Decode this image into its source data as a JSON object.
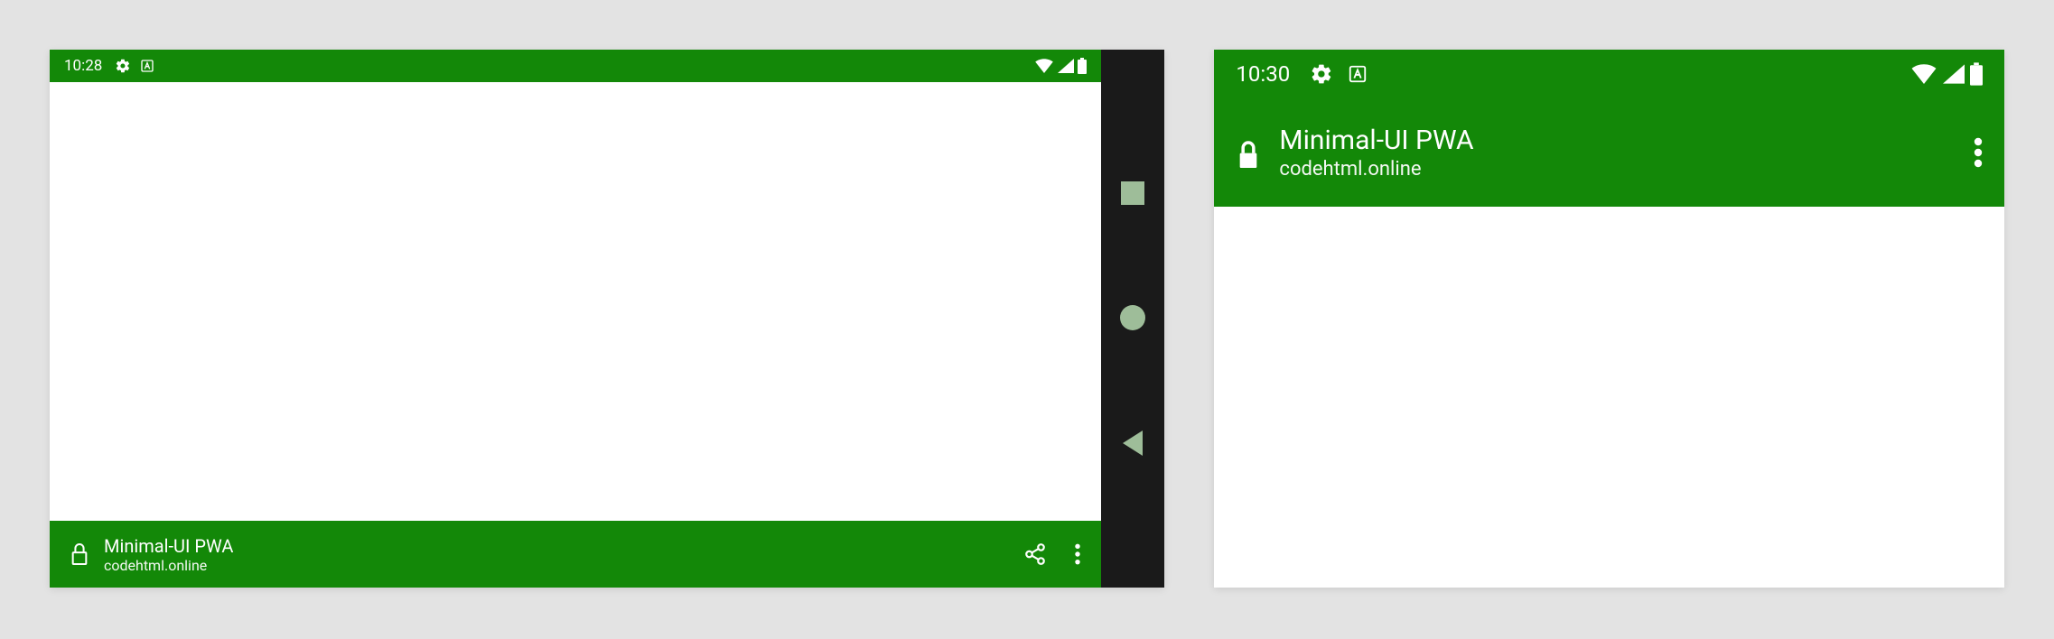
{
  "colors": {
    "brand": "#138808",
    "navBar": "#1a1a1a",
    "navIcon": "#9ebd99"
  },
  "left": {
    "status": {
      "time": "10:28"
    },
    "app": {
      "title": "Minimal-UI PWA",
      "subtitle": "codehtml.online"
    }
  },
  "right": {
    "status": {
      "time": "10:30"
    },
    "app": {
      "title": "Minimal-UI PWA",
      "subtitle": "codehtml.online"
    }
  }
}
